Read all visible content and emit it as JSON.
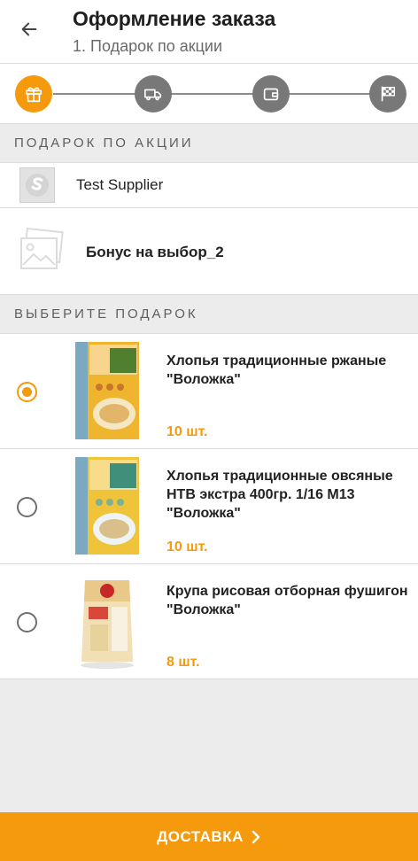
{
  "header": {
    "title": "Оформление заказа",
    "subtitle": "1. Подарок по акции",
    "back_icon": "arrow-left-icon"
  },
  "stepper": {
    "steps": [
      {
        "icon": "gift-icon",
        "active": true
      },
      {
        "icon": "delivery-truck-icon",
        "active": false
      },
      {
        "icon": "wallet-icon",
        "active": false
      },
      {
        "icon": "finish-flag-icon",
        "active": false
      }
    ]
  },
  "gift_section": {
    "header": "ПОДАРОК ПО АКЦИИ",
    "supplier_name": "Test Supplier",
    "bonus_name": "Бонус на выбор_2"
  },
  "choose_section": {
    "header": "ВЫБЕРИТЕ ПОДАРОК",
    "products": [
      {
        "name": "Хлопья традиционные ржаные \"Воложка\"",
        "quantity": "10 шт.",
        "selected": true
      },
      {
        "name": "Хлопья традиционные овсяные НТВ экстра 400гр. 1/16 М13 \"Воложка\"",
        "quantity": "10 шт.",
        "selected": false
      },
      {
        "name": "Крупа рисовая отборная фушигон \"Воложка\"",
        "quantity": "8 шт.",
        "selected": false
      }
    ]
  },
  "footer": {
    "button_label": "ДОСТАВКА",
    "button_icon": "chevron-right-icon"
  },
  "colors": {
    "accent": "#f59a0c",
    "step_inactive": "#787878",
    "background": "#ececec"
  }
}
